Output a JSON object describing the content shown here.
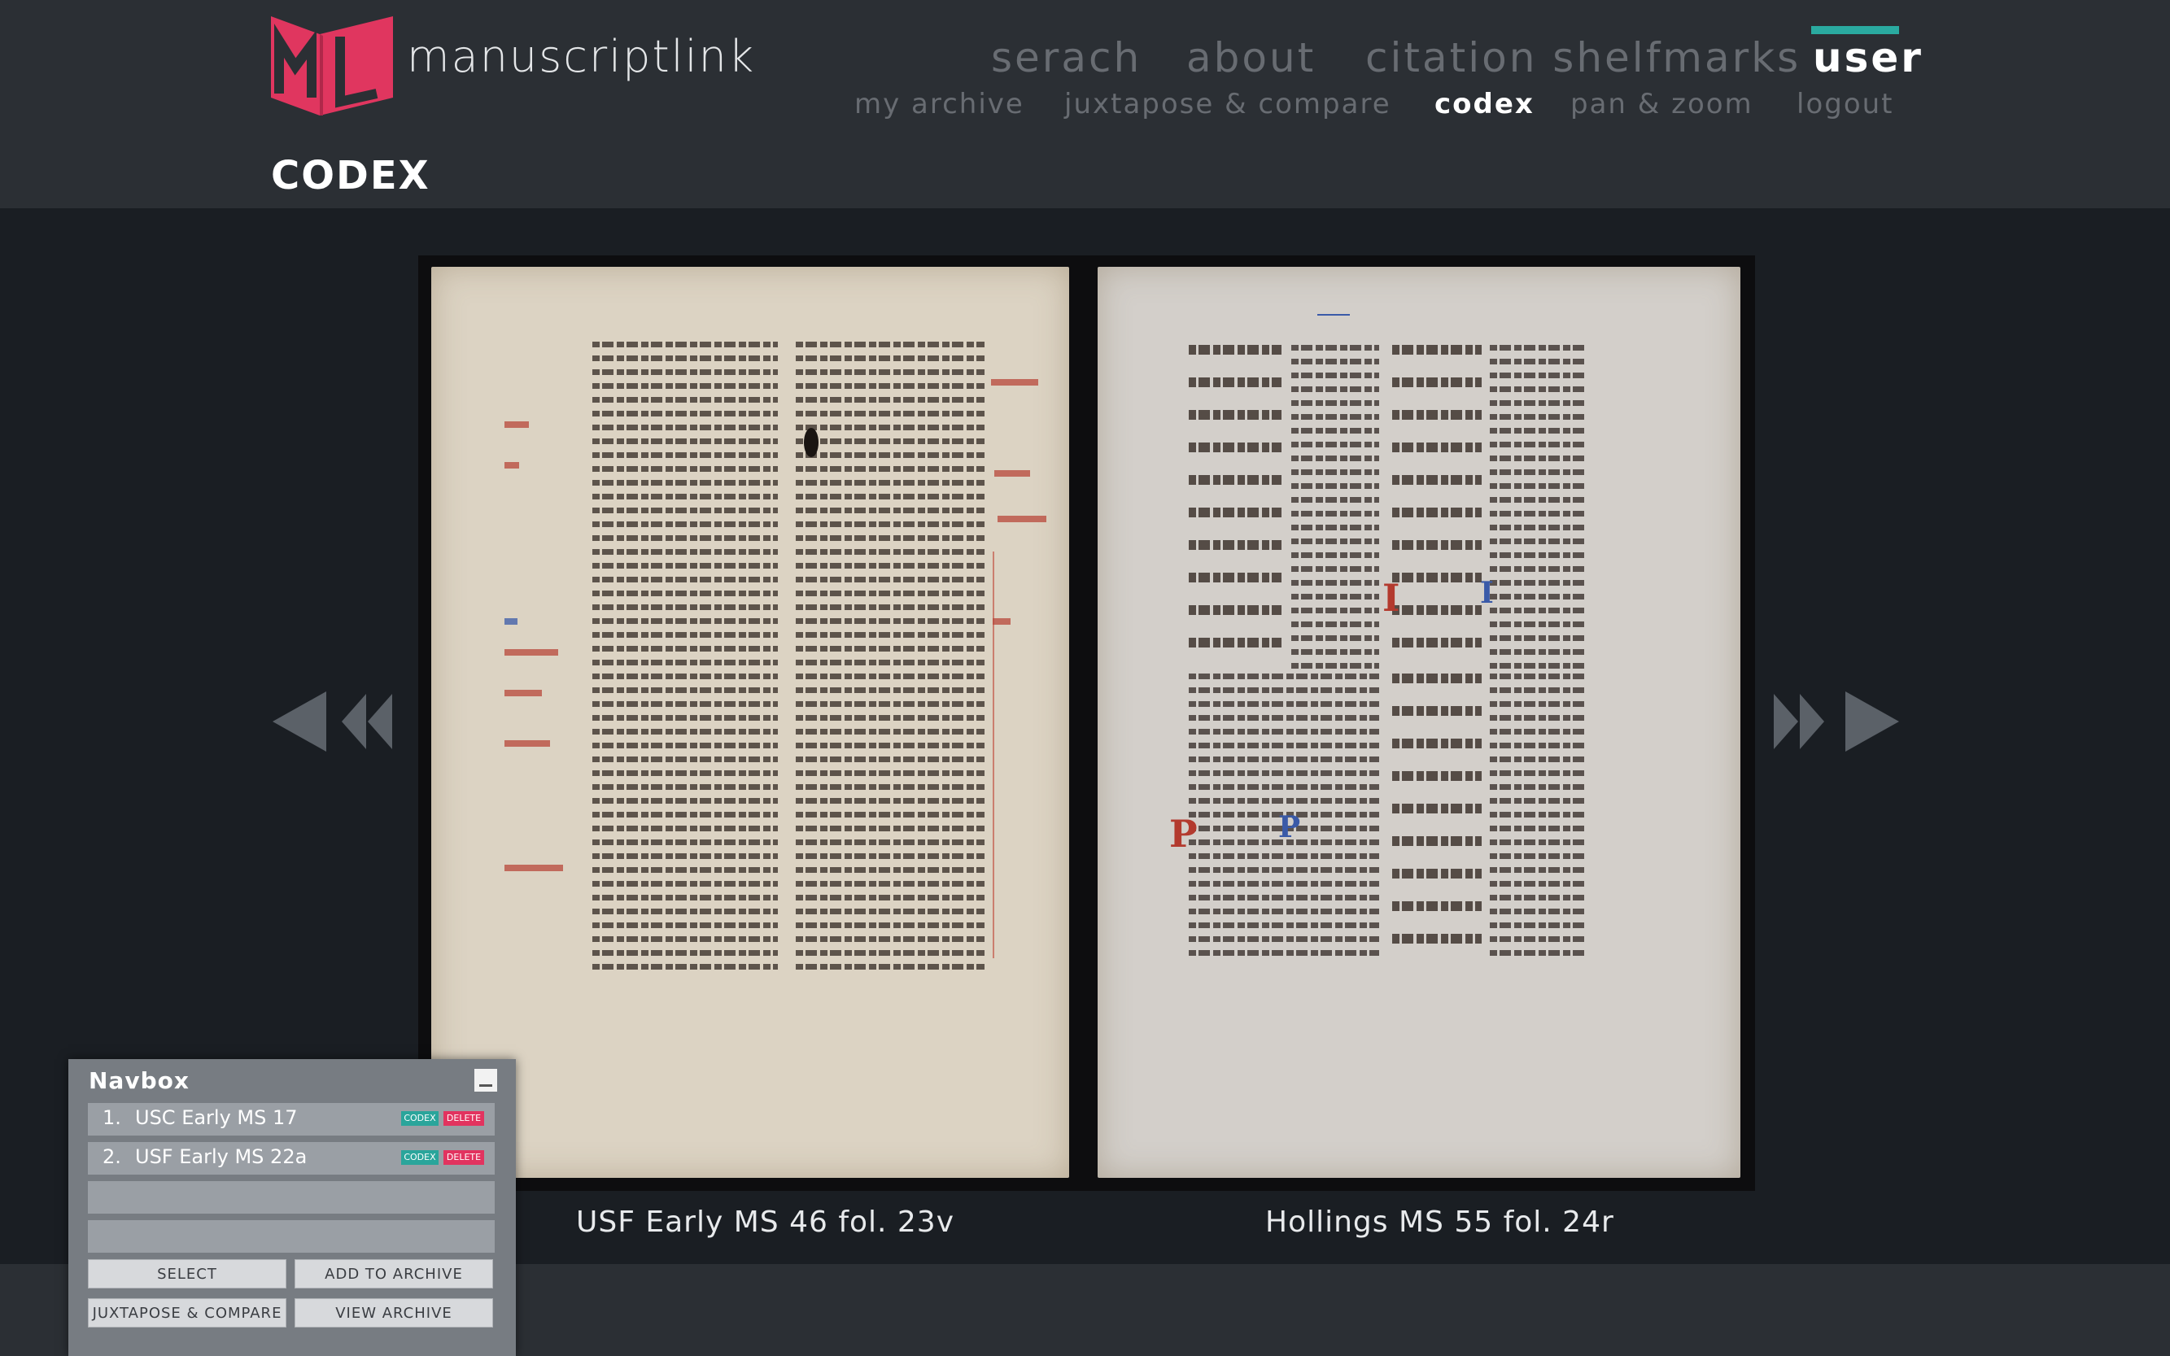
{
  "brand": {
    "name": "manuscriptlink",
    "logo_letters": "ML",
    "logo_color": "#e0365f"
  },
  "nav": {
    "main": [
      "serach",
      "about",
      "citation shelfmarks",
      "user"
    ],
    "active_main": "user",
    "sub": [
      "my archive",
      "juxtapose & compare",
      "codex",
      "pan & zoom",
      "logout"
    ],
    "active_sub": "codex",
    "accent_color": "#2aaaa0"
  },
  "page_title": "CODEX",
  "viewer": {
    "left_caption": "USF Early MS 46 fol. 23v",
    "right_caption": "Hollings MS 55 fol. 24r",
    "prev_icon": "rewind-icon",
    "next_icon": "fast-forward-icon"
  },
  "navbox": {
    "title": "Navbox",
    "items": [
      {
        "num": "1.",
        "name": "USC Early MS 17",
        "codex": "CODEX",
        "delete": "DELETE"
      },
      {
        "num": "2.",
        "name": "USF Early MS 22a",
        "codex": "CODEX",
        "delete": "DELETE"
      }
    ],
    "buttons": {
      "select": "SELECT",
      "add_to_archive": "ADD TO ARCHIVE",
      "juxtapose": "JUXTAPOSE & COMPARE",
      "view_archive": "VIEW ARCHIVE"
    }
  }
}
